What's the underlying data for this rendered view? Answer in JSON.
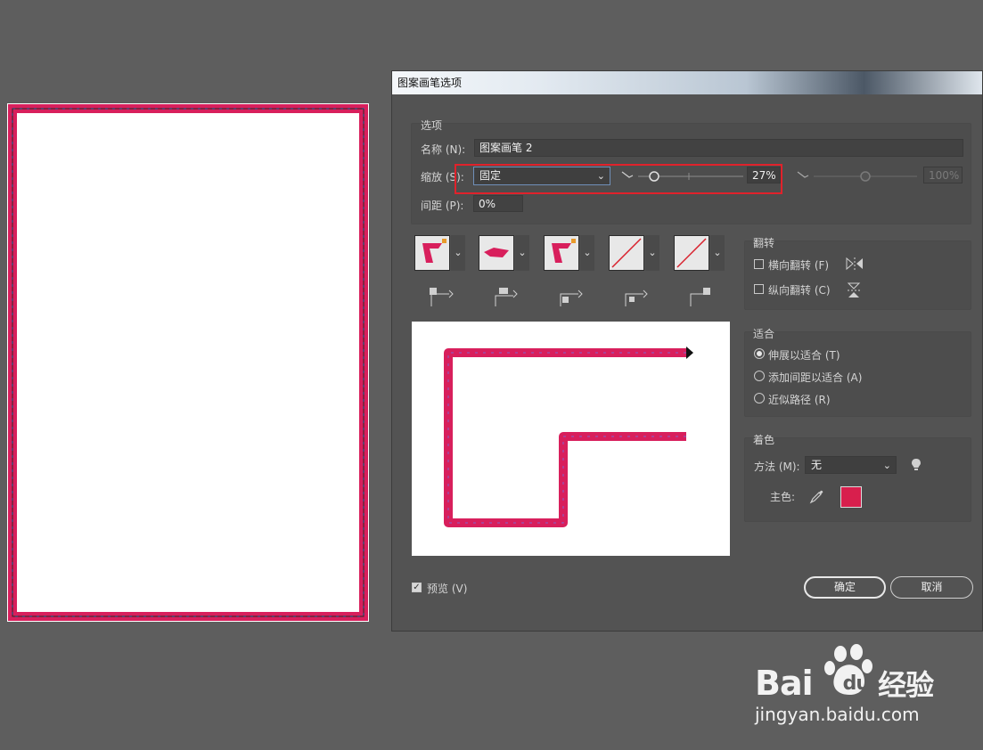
{
  "dialog": {
    "title": "图案画笔选项",
    "options_group": {
      "title": "选项",
      "name_label": "名称 (N):",
      "name_value": "图案画笔 2",
      "scale_label": "缩放 (S):",
      "scale_method": "固定",
      "scale_value": "27%",
      "scale_max_value": "100%",
      "spacing_label": "间距 (P):",
      "spacing_value": "0%"
    },
    "tiles": [
      {
        "name": "side-tile",
        "icon": "pattern-corner-swatch"
      },
      {
        "name": "outer-corner-tile",
        "icon": "pattern-side-swatch"
      },
      {
        "name": "inner-corner-tile",
        "icon": "pattern-corner-swatch"
      },
      {
        "name": "start-tile",
        "icon": "none-swatch"
      },
      {
        "name": "end-tile",
        "icon": "none-swatch"
      }
    ],
    "flip_group": {
      "title": "翻转",
      "flip_along": "横向翻转 (F)",
      "flip_across": "纵向翻转 (C)"
    },
    "fit_group": {
      "title": "适合",
      "options": [
        "伸展以适合 (T)",
        "添加间距以适合 (A)",
        "近似路径 (R)"
      ],
      "selected": 0
    },
    "colorization_group": {
      "title": "着色",
      "method_label": "方法 (M):",
      "method_value": "无",
      "key_color_label": "主色:"
    },
    "preview_label": "预览 (V)",
    "preview_checked": true,
    "ok_label": "确定",
    "cancel_label": "取消"
  },
  "colors": {
    "pattern": "#d81f5c",
    "pattern_accent": "#8a5fc7",
    "key_color": "#d81f4d",
    "highlight": "#e0222b"
  },
  "watermark": {
    "brand": "Bai",
    "brand_tail": "du",
    "brand_cn": "经验",
    "url": "jingyan.baidu.com"
  }
}
